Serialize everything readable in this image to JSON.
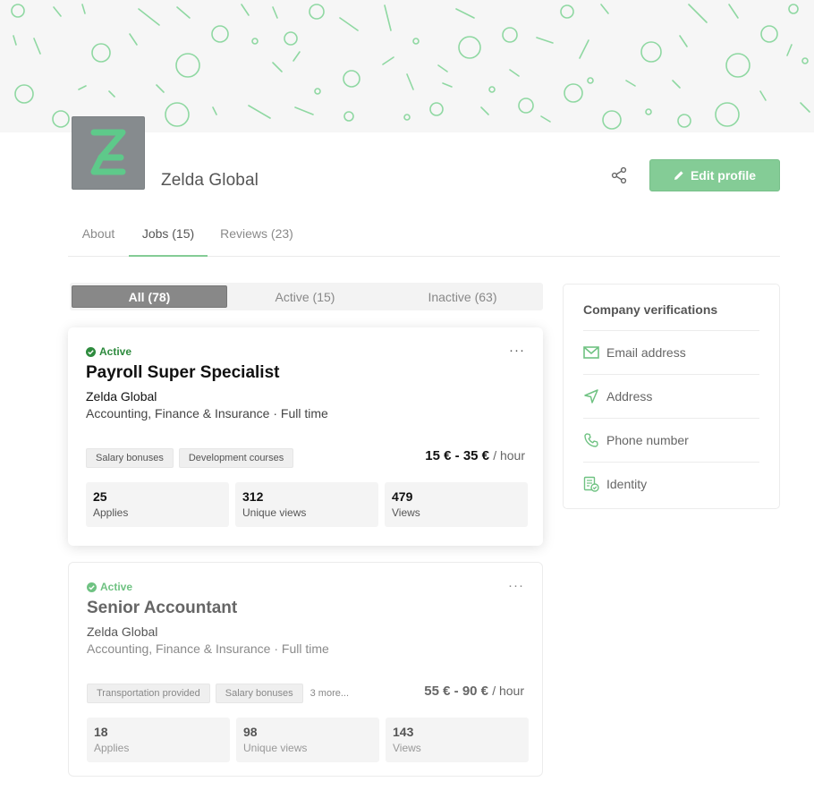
{
  "company": {
    "name": "Zelda Global",
    "logo_letter": "Z"
  },
  "actions": {
    "share_icon": "share-icon",
    "edit_label": "Edit profile"
  },
  "tabs": [
    {
      "label": "About"
    },
    {
      "label": "Jobs (15)"
    },
    {
      "label": "Reviews (23)"
    }
  ],
  "filters": [
    {
      "label": "All (78)"
    },
    {
      "label": "Active (15)"
    },
    {
      "label": "Inactive (63)"
    }
  ],
  "jobs": [
    {
      "status": "Active",
      "title": "Payroll Super Specialist",
      "company": "Zelda Global",
      "category": "Accounting, Finance & Insurance · Full time",
      "tags": [
        "Salary bonuses",
        "Development courses"
      ],
      "more_tags": "",
      "salary": "15 € - 35 €",
      "salary_unit": "/ hour",
      "stats": [
        {
          "value": "25",
          "label": "Applies"
        },
        {
          "value": "312",
          "label": "Unique views"
        },
        {
          "value": "479",
          "label": "Views"
        }
      ]
    },
    {
      "status": "Active",
      "title": "Senior Accountant",
      "company": "Zelda Global",
      "category": "Accounting, Finance & Insurance · Full time",
      "tags": [
        "Transportation provided",
        "Salary bonuses"
      ],
      "more_tags": "3 more...",
      "salary": "55 € - 90 €",
      "salary_unit": "/ hour",
      "stats": [
        {
          "value": "18",
          "label": "Applies"
        },
        {
          "value": "98",
          "label": "Unique views"
        },
        {
          "value": "143",
          "label": "Views"
        }
      ]
    }
  ],
  "verifications": {
    "title": "Company verifications",
    "items": [
      {
        "label": "Email address",
        "icon": "envelope-icon"
      },
      {
        "label": "Address",
        "icon": "location-arrow-icon"
      },
      {
        "label": "Phone number",
        "icon": "phone-icon"
      },
      {
        "label": "Identity",
        "icon": "id-check-icon"
      }
    ]
  },
  "colors": {
    "accent": "#84cc96",
    "active_status": "#2e8b3e",
    "banner_pattern": "#8fd8a2"
  }
}
